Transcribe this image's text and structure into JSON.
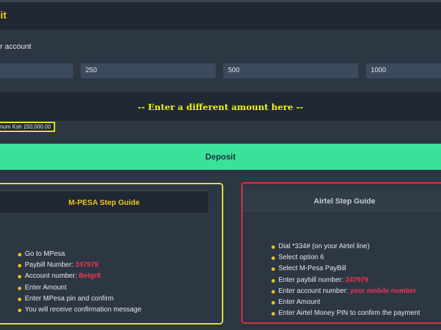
{
  "header": {
    "title": "sit"
  },
  "subtitle": "ur account",
  "amounts": [
    "",
    "250",
    "500",
    "1000"
  ],
  "different_amount": {
    "placeholder": "-- Enter a different amount here --"
  },
  "note": "num Ksh 150,000.00",
  "deposit_button": "Deposit",
  "mpesa": {
    "title": "M-PESA Step Guide",
    "steps": [
      {
        "text": "Go to MPesa",
        "highlight": ""
      },
      {
        "text": "Paybill Number: ",
        "highlight": "247979"
      },
      {
        "text": "Account number: ",
        "highlight": "Betgr8"
      },
      {
        "text": "Enter Amount",
        "highlight": ""
      },
      {
        "text": "Enter MPesa pin and confirm",
        "highlight": ""
      },
      {
        "text": "You will receive confirmation message",
        "highlight": ""
      }
    ]
  },
  "airtel": {
    "title": "Airtel Step Guide",
    "steps": [
      {
        "text": "Dial *334# (on your Airtel line)",
        "highlight": ""
      },
      {
        "text": "Select option 6",
        "highlight": ""
      },
      {
        "text": "Select M-Pesa PayBill",
        "highlight": ""
      },
      {
        "text": "Enter paybill number: ",
        "highlight": "247979"
      },
      {
        "text": "Enter account number: ",
        "highlight": "your mobile number"
      },
      {
        "text": "Enter Amount",
        "highlight": ""
      },
      {
        "text": "Enter Airtel Money PIN to confirm the payment",
        "highlight": ""
      }
    ]
  },
  "colors": {
    "accent_yellow": "#f2c21a",
    "deposit_green": "#39e29a",
    "highlight_red": "#f2324f",
    "airtel_border": "#e0323b",
    "mpesa_border": "#e6e63a"
  }
}
